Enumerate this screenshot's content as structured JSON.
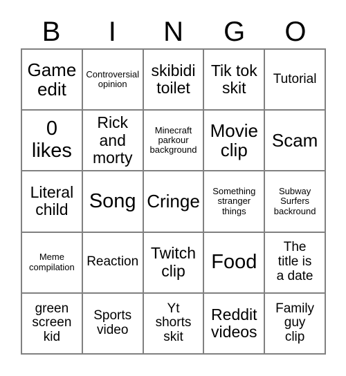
{
  "card": {
    "title_letters": [
      "B",
      "I",
      "N",
      "G",
      "O"
    ],
    "border_color": "#808080",
    "background_color": "#ffffff",
    "text_color": "#000000",
    "columns": 5,
    "rows": 5,
    "cells": [
      {
        "text": "Game\nedit",
        "size": "lg"
      },
      {
        "text": "Controversial\nopinion",
        "size": "xs"
      },
      {
        "text": "skibidi\ntoilet",
        "size": "md"
      },
      {
        "text": "Tik tok\nskit",
        "size": "md"
      },
      {
        "text": "Tutorial",
        "size": "sm"
      },
      {
        "text": "0\nlikes",
        "size": "xl"
      },
      {
        "text": "Rick\nand\nmorty",
        "size": "md"
      },
      {
        "text": "Minecraft\nparkour\nbackground",
        "size": "xs"
      },
      {
        "text": "Movie\nclip",
        "size": "lg"
      },
      {
        "text": "Scam",
        "size": "lg"
      },
      {
        "text": "Literal\nchild",
        "size": "md"
      },
      {
        "text": "Song",
        "size": "xl"
      },
      {
        "text": "Cringe",
        "size": "lg"
      },
      {
        "text": "Something\nstranger\nthings",
        "size": "xs"
      },
      {
        "text": "Subway\nSurfers\nbackround",
        "size": "xs"
      },
      {
        "text": "Meme\ncompilation",
        "size": "xs"
      },
      {
        "text": "Reaction",
        "size": "sm"
      },
      {
        "text": "Twitch\nclip",
        "size": "md"
      },
      {
        "text": "Food",
        "size": "xl"
      },
      {
        "text": "The\ntitle is\na date",
        "size": "sm"
      },
      {
        "text": "green\nscreen\nkid",
        "size": "sm"
      },
      {
        "text": "Sports\nvideo",
        "size": "sm"
      },
      {
        "text": "Yt\nshorts\nskit",
        "size": "sm"
      },
      {
        "text": "Reddit\nvideos",
        "size": "md"
      },
      {
        "text": "Family\nguy\nclip",
        "size": "sm"
      }
    ]
  }
}
